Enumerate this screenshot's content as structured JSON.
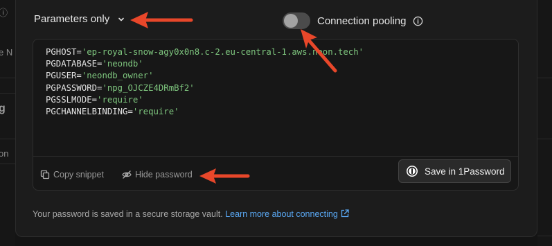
{
  "background": {
    "left_fragments": [
      "e N",
      "g",
      "on"
    ]
  },
  "connection": {
    "mode_label": "Parameters only",
    "pooling_label": "Connection pooling",
    "pooling_enabled": false
  },
  "snippet": {
    "lines": [
      {
        "key": "PGHOST",
        "value": "'ep-royal-snow-agy0x0n8.c-2.eu-central-1.aws.neon.tech'"
      },
      {
        "key": "PGDATABASE",
        "value": "'neondb'"
      },
      {
        "key": "PGUSER",
        "value": "'neondb_owner'"
      },
      {
        "key": "PGPASSWORD",
        "value": "'npg_OJCZE4DRmBf2'"
      },
      {
        "key": "PGSSLMODE",
        "value": "'require'"
      },
      {
        "key": "PGCHANNELBINDING",
        "value": "'require'"
      }
    ]
  },
  "footer": {
    "copy_label": "Copy snippet",
    "hide_label": "Hide password",
    "onepassword_label": "Save in 1Password"
  },
  "note": {
    "text": "Your password is saved in a secure storage vault.",
    "link": "Learn more about connecting"
  },
  "colors": {
    "accent_arrow": "#e8472a",
    "link": "#5aa9f5",
    "code_value": "#7fc77f"
  }
}
